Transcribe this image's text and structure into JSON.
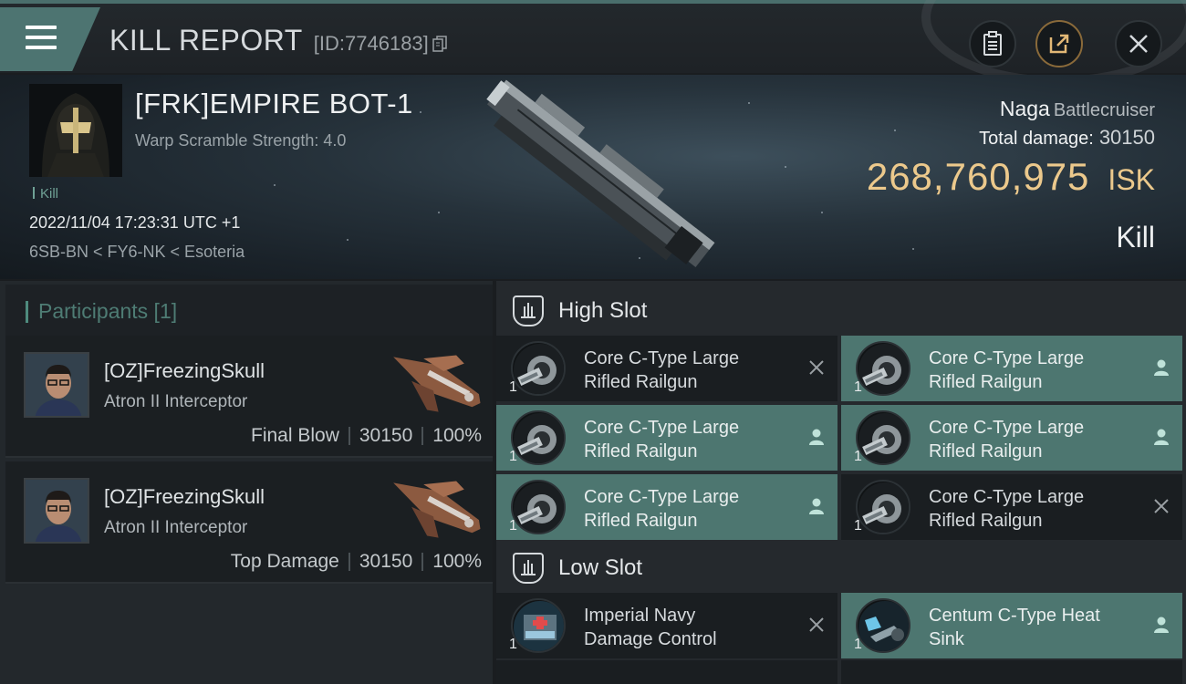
{
  "header": {
    "title": "KILL REPORT",
    "report_id": "[ID:7746183]"
  },
  "victim": {
    "name": "[FRK]EMPIRE BOT-1",
    "warp_scramble": "Warp Scramble Strength: 4.0",
    "kill_tag": "Kill",
    "timestamp": "2022/11/04 17:23:31 UTC +1",
    "location": "6SB-BN < FY6-NK < Esoteria",
    "ship_name": "Naga",
    "ship_class": "Battlecruiser",
    "total_damage_label": "Total damage:",
    "total_damage": "30150",
    "isk_value": "268,760,975",
    "isk_unit": "ISK",
    "result": "Kill"
  },
  "participants": {
    "title": "Participants [1]",
    "items": [
      {
        "name": "[OZ]FreezingSkull",
        "ship": "Atron II Interceptor",
        "role": "Final Blow",
        "damage": "30150",
        "percent": "100%"
      },
      {
        "name": "[OZ]FreezingSkull",
        "ship": "Atron II Interceptor",
        "role": "Top Damage",
        "damage": "30150",
        "percent": "100%"
      }
    ]
  },
  "high_slot": {
    "title": "High Slot",
    "modules": [
      {
        "name_1": "Core C-Type Large",
        "name_2": "Rifled Railgun",
        "qty": "1",
        "state": "destroyed",
        "style": "dark"
      },
      {
        "name_1": "Core C-Type Large",
        "name_2": "Rifled Railgun",
        "qty": "1",
        "state": "dropped",
        "style": "teal"
      },
      {
        "name_1": "Core C-Type Large",
        "name_2": "Rifled Railgun",
        "qty": "1",
        "state": "dropped",
        "style": "teal"
      },
      {
        "name_1": "Core C-Type Large",
        "name_2": "Rifled Railgun",
        "qty": "1",
        "state": "dropped",
        "style": "teal"
      },
      {
        "name_1": "Core C-Type Large",
        "name_2": "Rifled Railgun",
        "qty": "1",
        "state": "dropped",
        "style": "teal"
      },
      {
        "name_1": "Core C-Type Large",
        "name_2": "Rifled Railgun",
        "qty": "1",
        "state": "destroyed",
        "style": "dark"
      }
    ]
  },
  "low_slot": {
    "title": "Low Slot",
    "modules": [
      {
        "name_1": "Imperial Navy",
        "name_2": "Damage Control",
        "qty": "1",
        "state": "destroyed",
        "style": "dark"
      },
      {
        "name_1": "Centum C-Type Heat",
        "name_2": "Sink",
        "qty": "1",
        "state": "dropped",
        "style": "teal"
      }
    ]
  },
  "colors": {
    "accent_teal": "#4d7670",
    "isk_gold": "#ecc98c",
    "participants_title": "#4e7c74"
  },
  "icons": {
    "menu": "hamburger-icon",
    "copy": "copy-icon",
    "clipboard": "clipboard-icon",
    "share": "share-icon",
    "close": "close-icon",
    "slot": "high-slot-icon",
    "destroyed": "destroyed-x-icon",
    "dropped": "person-icon"
  }
}
